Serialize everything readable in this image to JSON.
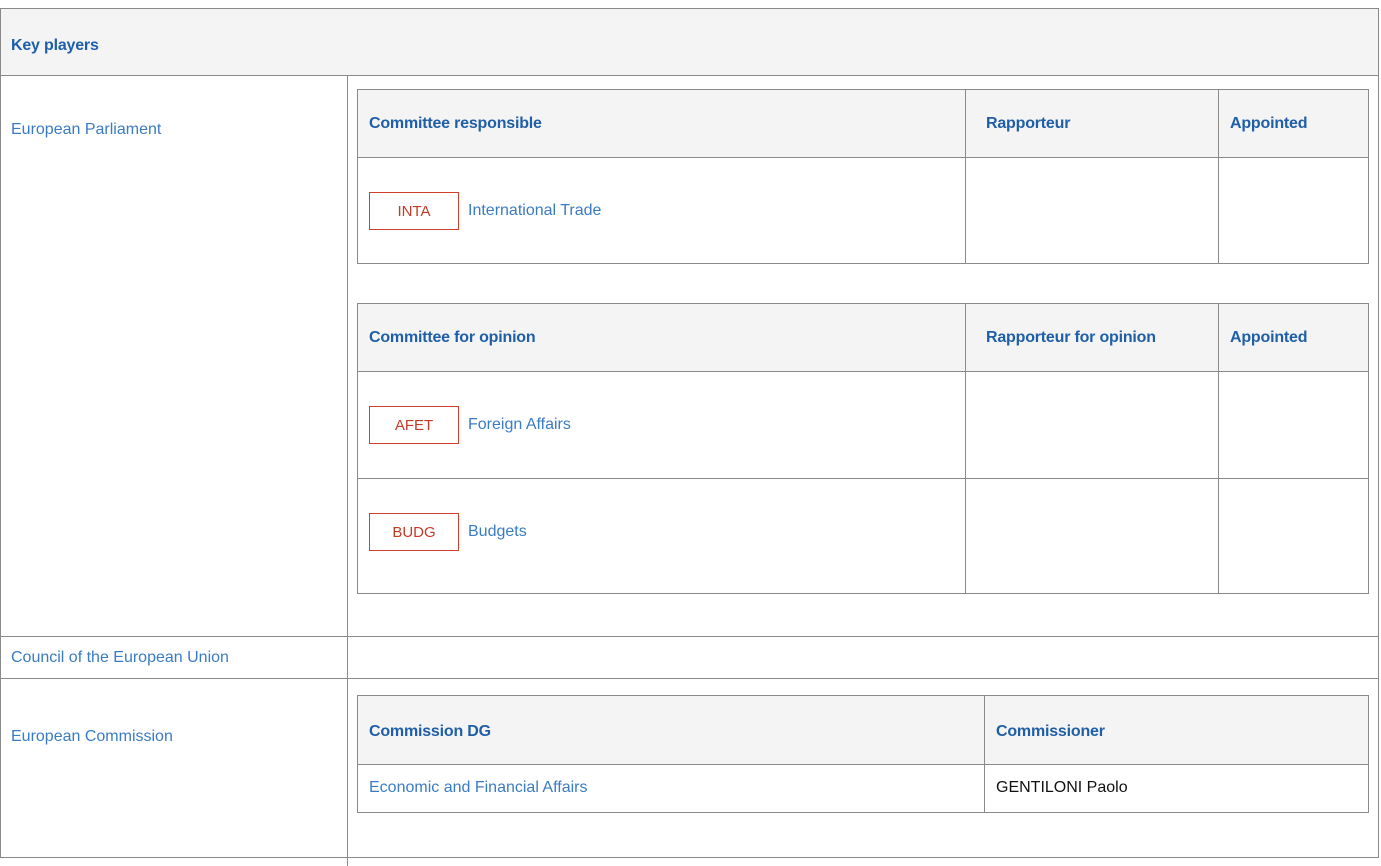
{
  "section_title": "Key players",
  "rows": {
    "parliament": "European Parliament",
    "council": "Council of the European Union",
    "commission": "European Commission"
  },
  "responsible_table": {
    "headers": [
      "Committee responsible",
      "Rapporteur",
      "Appointed"
    ],
    "rows": [
      {
        "code": "INTA",
        "name": "International Trade",
        "rapporteur": "",
        "appointed": ""
      }
    ]
  },
  "opinion_table": {
    "headers": [
      "Committee for opinion",
      "Rapporteur for opinion",
      "Appointed"
    ],
    "rows": [
      {
        "code": "AFET",
        "name": "Foreign Affairs",
        "rapporteur": "",
        "appointed": ""
      },
      {
        "code": "BUDG",
        "name": "Budgets",
        "rapporteur": "",
        "appointed": ""
      }
    ]
  },
  "commission_table": {
    "headers": [
      "Commission DG",
      "Commissioner"
    ],
    "rows": [
      {
        "dg": "Economic and Financial Affairs",
        "commissioner": "GENTILONI Paolo"
      }
    ]
  },
  "colors": {
    "link": "#3a7cc4",
    "header_text": "#1f5fa8",
    "badge": "#d2402b",
    "border": "#8a8a8a",
    "header_bg": "#f4f4f4"
  }
}
